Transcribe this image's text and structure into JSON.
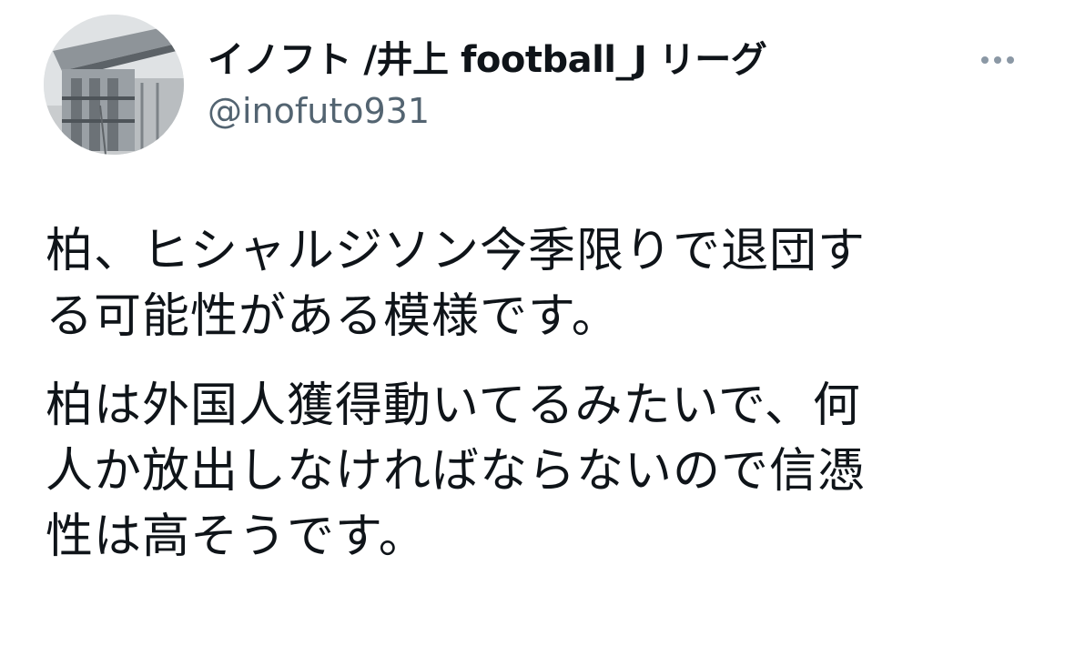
{
  "author": {
    "display_name": "イノフト /井上 football_J リーグ",
    "handle": "@inofuto931",
    "avatar_icon": "stadium-photo-avatar"
  },
  "menu": {
    "icon": "more-horizontal-icon"
  },
  "tweet": {
    "paragraph_1": "柏、ヒシャルジソン今季限りで退団す\nる可能性がある模様です。",
    "paragraph_2": "柏は外国人獲得動いてるみたいで、何\n人か放出しなければならないので信憑\n性は高そうです。"
  },
  "colors": {
    "text": "#0f1419",
    "secondary": "#536471",
    "icon": "#8b98a5"
  }
}
